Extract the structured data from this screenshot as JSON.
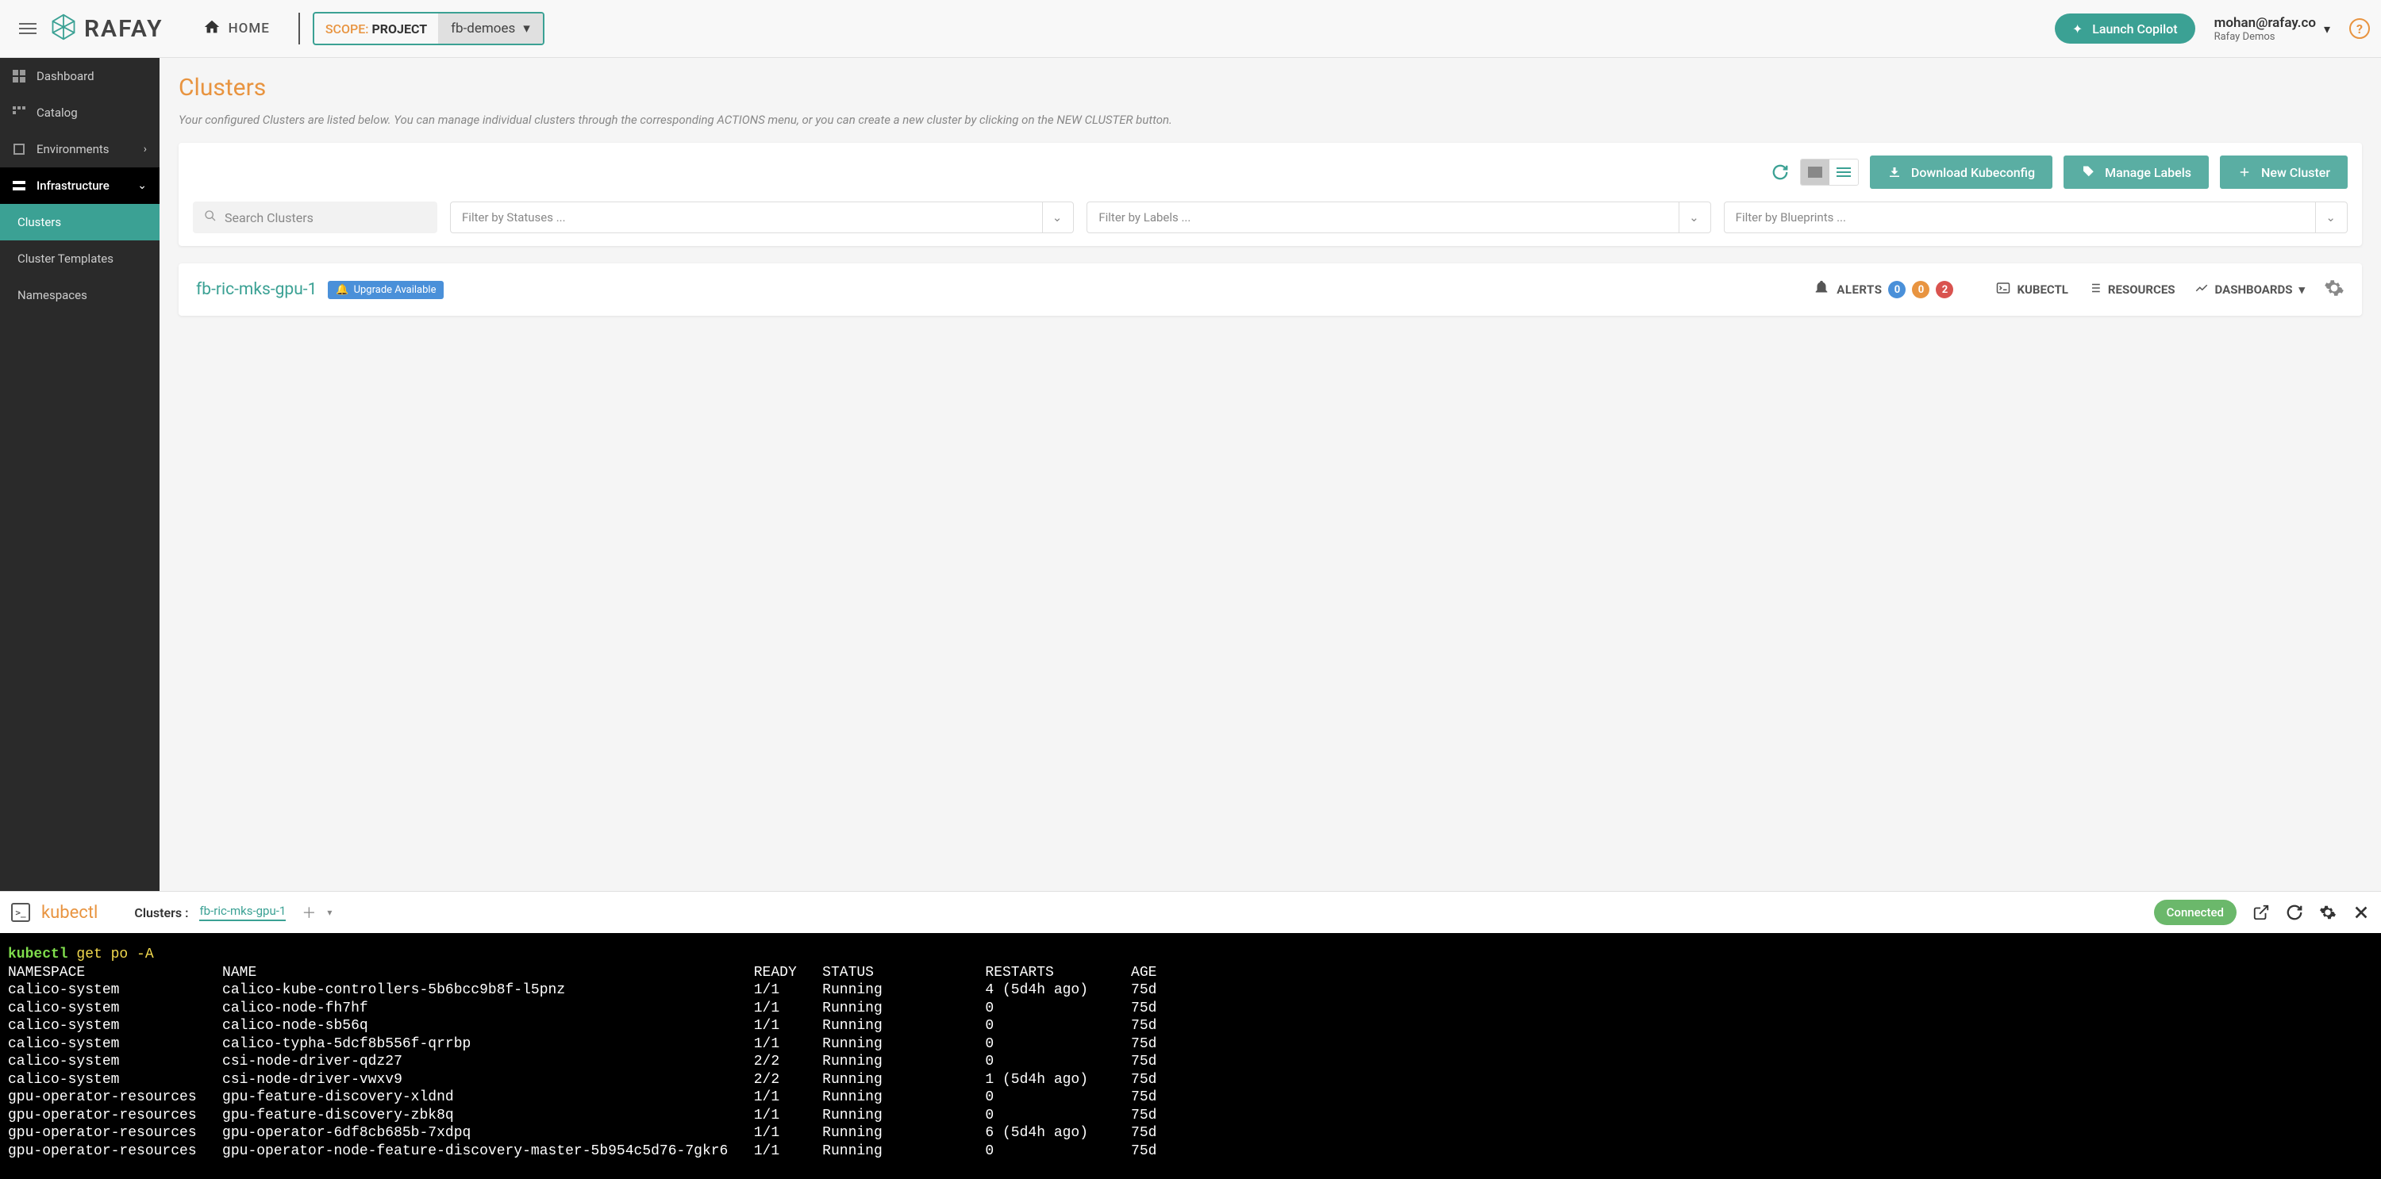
{
  "brand": {
    "name": "RAFAY"
  },
  "header": {
    "home": "HOME",
    "scope_label": "SCOPE:",
    "scope_value": "PROJECT",
    "project": "fb-demoes",
    "copilot": "Launch Copilot",
    "user_email": "mohan@rafay.co",
    "user_org": "Rafay Demos"
  },
  "sidebar": {
    "items": [
      {
        "label": "Dashboard",
        "icon": "dashboard-icon"
      },
      {
        "label": "Catalog",
        "icon": "catalog-icon"
      },
      {
        "label": "Environments",
        "icon": "env-icon",
        "expandable": true
      },
      {
        "label": "Infrastructure",
        "icon": "infra-icon",
        "expandable": true
      }
    ],
    "subs": [
      {
        "label": "Clusters",
        "active": true
      },
      {
        "label": "Cluster Templates"
      },
      {
        "label": "Namespaces"
      }
    ]
  },
  "page": {
    "title": "Clusters",
    "desc": "Your configured Clusters are listed below. You can manage individual clusters through the corresponding ACTIONS menu, or you can create a new cluster by clicking on the NEW CLUSTER button."
  },
  "toolbar": {
    "download": "Download Kubeconfig",
    "manage_labels": "Manage Labels",
    "new_cluster": "New Cluster",
    "search_placeholder": "Search Clusters",
    "filter_status": "Filter by Statuses ...",
    "filter_labels": "Filter by Labels ...",
    "filter_blueprints": "Filter by Blueprints ..."
  },
  "cluster": {
    "name": "fb-ric-mks-gpu-1",
    "upgrade": "Upgrade Available",
    "alerts_label": "ALERTS",
    "badges": [
      "0",
      "0",
      "2"
    ],
    "actions": {
      "kubectl": "KUBECTL",
      "resources": "RESOURCES",
      "dashboards": "DASHBOARDS"
    }
  },
  "kubectl": {
    "title": "kubectl",
    "clusters_label": "Clusters :",
    "selected": "fb-ric-mks-gpu-1",
    "connected": "Connected",
    "prompt": "kubectl",
    "command": " get po -A",
    "columns": [
      "NAMESPACE",
      "NAME",
      "READY",
      "STATUS",
      "RESTARTS",
      "AGE"
    ],
    "rows": [
      [
        "calico-system",
        "calico-kube-controllers-5b6bcc9b8f-l5pnz",
        "1/1",
        "Running",
        "4 (5d4h ago)",
        "75d"
      ],
      [
        "calico-system",
        "calico-node-fh7hf",
        "1/1",
        "Running",
        "0",
        "75d"
      ],
      [
        "calico-system",
        "calico-node-sb56q",
        "1/1",
        "Running",
        "0",
        "75d"
      ],
      [
        "calico-system",
        "calico-typha-5dcf8b556f-qrrbp",
        "1/1",
        "Running",
        "0",
        "75d"
      ],
      [
        "calico-system",
        "csi-node-driver-qdz27",
        "2/2",
        "Running",
        "0",
        "75d"
      ],
      [
        "calico-system",
        "csi-node-driver-vwxv9",
        "2/2",
        "Running",
        "1 (5d4h ago)",
        "75d"
      ],
      [
        "gpu-operator-resources",
        "gpu-feature-discovery-xldnd",
        "1/1",
        "Running",
        "0",
        "75d"
      ],
      [
        "gpu-operator-resources",
        "gpu-feature-discovery-zbk8q",
        "1/1",
        "Running",
        "0",
        "75d"
      ],
      [
        "gpu-operator-resources",
        "gpu-operator-6df8cb685b-7xdpq",
        "1/1",
        "Running",
        "6 (5d4h ago)",
        "75d"
      ],
      [
        "gpu-operator-resources",
        "gpu-operator-node-feature-discovery-master-5b954c5d76-7gkr6",
        "1/1",
        "Running",
        "0",
        "75d"
      ]
    ]
  }
}
